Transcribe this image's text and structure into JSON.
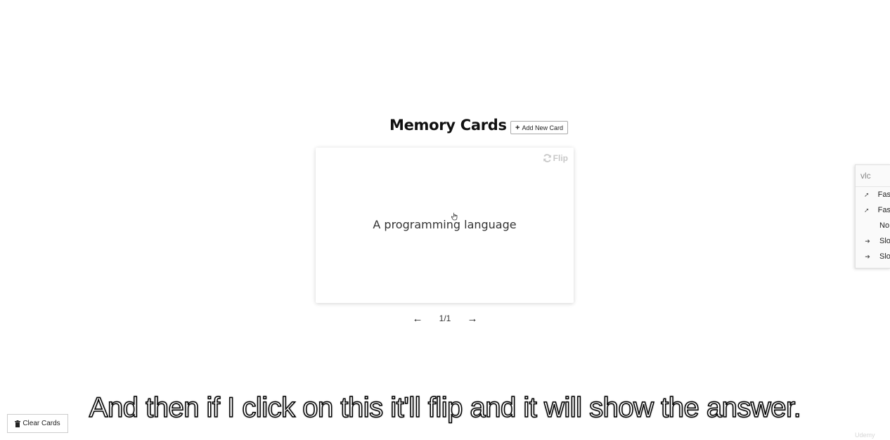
{
  "app": {
    "title": "Memory Cards",
    "add_button_label": "Add New Card",
    "clear_button_label": "Clear Cards"
  },
  "card": {
    "flip_label": "Flip",
    "text": "A programming language"
  },
  "navigation": {
    "page_counter": "1/1"
  },
  "vlc_menu": {
    "title": "vlc",
    "items": [
      {
        "label": "Fas",
        "icon": "faster-icon"
      },
      {
        "label": "Fas",
        "icon": "faster-fine-icon"
      },
      {
        "label": "No",
        "icon": ""
      },
      {
        "label": "Slo",
        "icon": "slower-fine-icon"
      },
      {
        "label": "Slo",
        "icon": "slower-icon"
      }
    ]
  },
  "subtitle": {
    "text": "And then if I click on this it'll flip and it will show the answer."
  },
  "watermark": {
    "text": "Udemy"
  }
}
